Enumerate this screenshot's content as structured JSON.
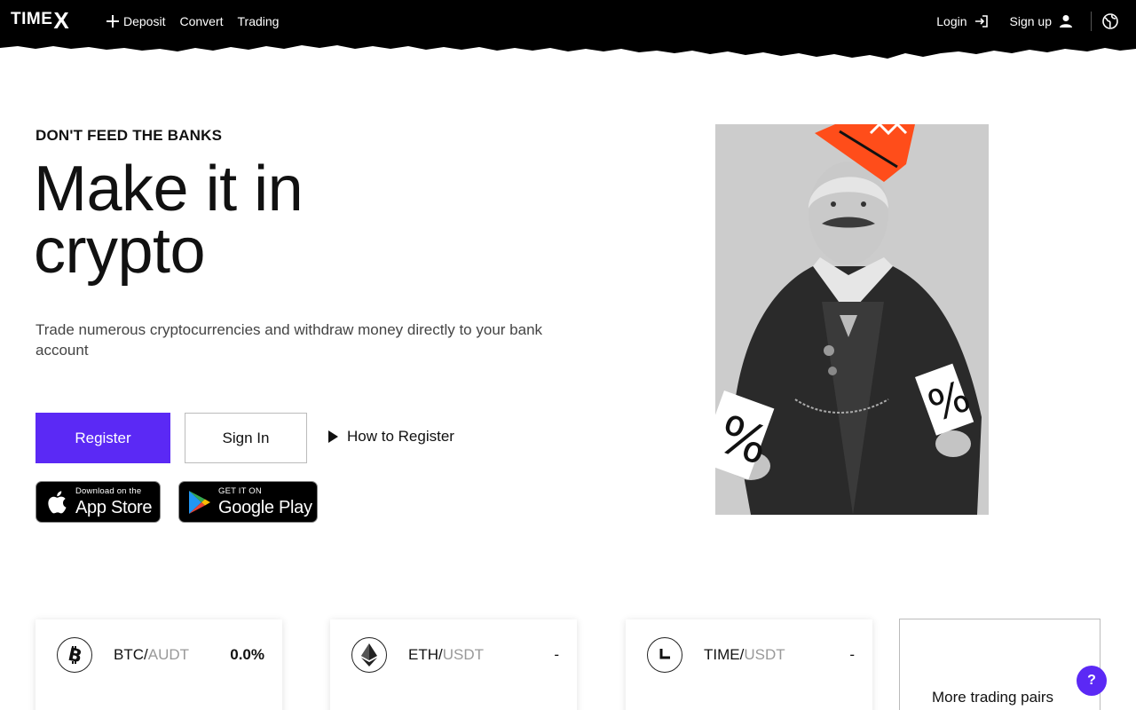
{
  "header": {
    "logo_text": "TIME",
    "logo_x": "X",
    "nav": [
      {
        "label": "Deposit",
        "icon": "plus-icon"
      },
      {
        "label": "Convert"
      },
      {
        "label": "Trading"
      }
    ],
    "login_label": "Login",
    "signup_label": "Sign up"
  },
  "hero": {
    "eyebrow": "DON'T FEED THE BANKS",
    "headline_line1": "Make it in",
    "headline_line2": "crypto",
    "subtext": "Trade numerous cryptocurrencies and withdraw money directly to your bank account",
    "register_label": "Register",
    "signin_label": "Sign In",
    "how_to_label": "How to Register"
  },
  "badges": {
    "apple_small": "Download on the",
    "apple_big": "App Store",
    "google_small": "GET IT ON",
    "google_big": "Google Play"
  },
  "tickers": [
    {
      "base": "BTC/",
      "quote": "AUDT",
      "value": "0.0%",
      "icon": "bitcoin-icon"
    },
    {
      "base": "ETH/",
      "quote": "USDT",
      "value": "-",
      "icon": "ethereum-icon"
    },
    {
      "base": "TIME/",
      "quote": "USDT",
      "value": "-",
      "icon": "time-icon"
    }
  ],
  "more_pairs_label": "More trading pairs",
  "help_label": "?",
  "colors": {
    "accent": "#5b29f5",
    "header_bg": "#000000",
    "crown": "#ff4d1a"
  }
}
